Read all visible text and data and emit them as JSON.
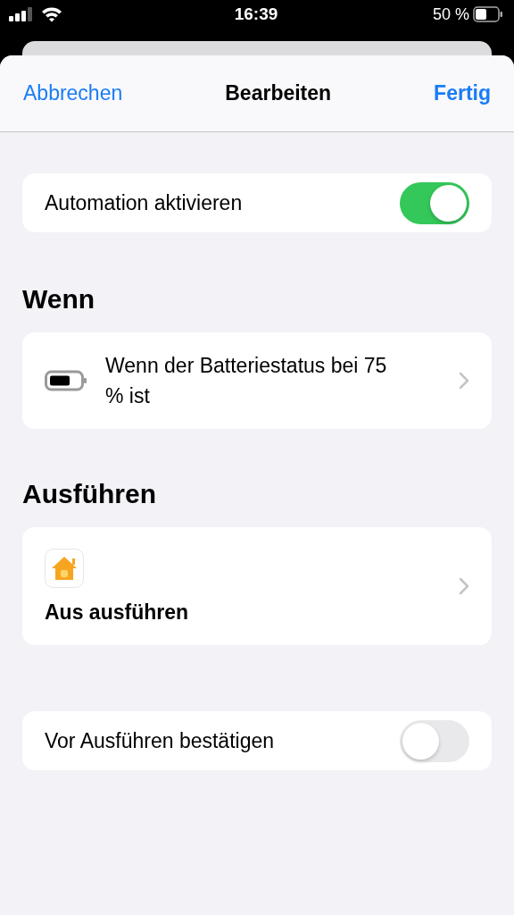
{
  "status_bar": {
    "time": "16:39",
    "battery_percent": "50 %"
  },
  "nav": {
    "cancel": "Abbrechen",
    "title": "Bearbeiten",
    "done": "Fertig"
  },
  "enable": {
    "label": "Automation aktivieren",
    "on": true
  },
  "when": {
    "heading": "Wenn",
    "condition": "Wenn der Batteriestatus bei 75 % ist"
  },
  "run": {
    "heading": "Ausführen",
    "action": "Aus ausführen"
  },
  "confirm": {
    "label": "Vor Ausführen bestätigen",
    "on": false
  }
}
